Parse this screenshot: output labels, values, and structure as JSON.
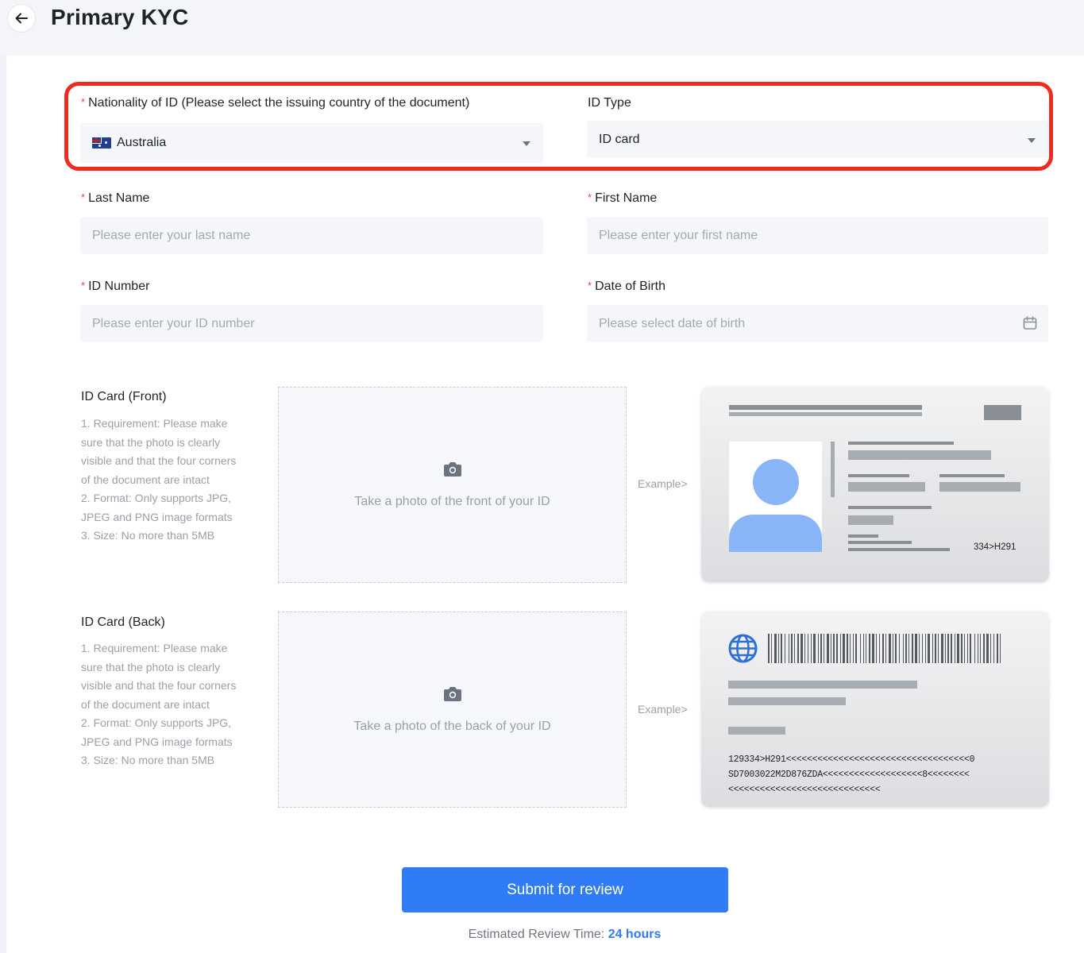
{
  "header": {
    "title": "Primary KYC"
  },
  "form": {
    "nationality": {
      "label": "Nationality of ID (Please select the issuing country of the document)",
      "value": "Australia",
      "flag_icon": "australia-flag-icon"
    },
    "id_type": {
      "label": "ID Type",
      "value": "ID card"
    },
    "last_name": {
      "label": "Last Name",
      "placeholder": "Please enter your last name"
    },
    "first_name": {
      "label": "First Name",
      "placeholder": "Please enter your first name"
    },
    "id_number": {
      "label": "ID Number",
      "placeholder": "Please enter your ID number"
    },
    "dob": {
      "label": "Date of Birth",
      "placeholder": "Please select date of birth"
    },
    "required_mark": "*"
  },
  "uploads": {
    "front": {
      "title": "ID Card (Front)",
      "desc": [
        "1. Requirement: Please make",
        "sure that the photo is clearly",
        "visible and that the four corners",
        "of the document are intact",
        "2. Format: Only supports JPG,",
        "JPEG and PNG image formats",
        "3. Size: No more than 5MB"
      ],
      "dropzone_text": "Take a photo of the front of your ID",
      "example_link": "Example>",
      "sample_code": "334>H291"
    },
    "back": {
      "title": "ID Card (Back)",
      "desc": [
        "1. Requirement: Please make",
        "sure that the photo is clearly",
        "visible and that the four corners",
        "of the document are intact",
        "2. Format: Only supports JPG,",
        "JPEG and PNG image formats",
        "3. Size: No more than 5MB"
      ],
      "dropzone_text": "Take a photo of the back of your ID",
      "example_link": "Example>",
      "mrz": [
        "129334>H291<<<<<<<<<<<<<<<<<<<<<<<<<<<<<<<<<<<0",
        "SD7003022M2D876ZDA<<<<<<<<<<<<<<<<<<<8<<<<<<<<",
        "<<<<<<<<<<<<<<<<<<<<<<<<<<<<<"
      ]
    }
  },
  "footer": {
    "submit_label": "Submit for review",
    "review_prefix": "Estimated Review Time:",
    "review_value": "24 hours"
  },
  "colors": {
    "accent": "#2f7cf6",
    "highlight": "#ef2b1f",
    "required": "#e8453c"
  }
}
